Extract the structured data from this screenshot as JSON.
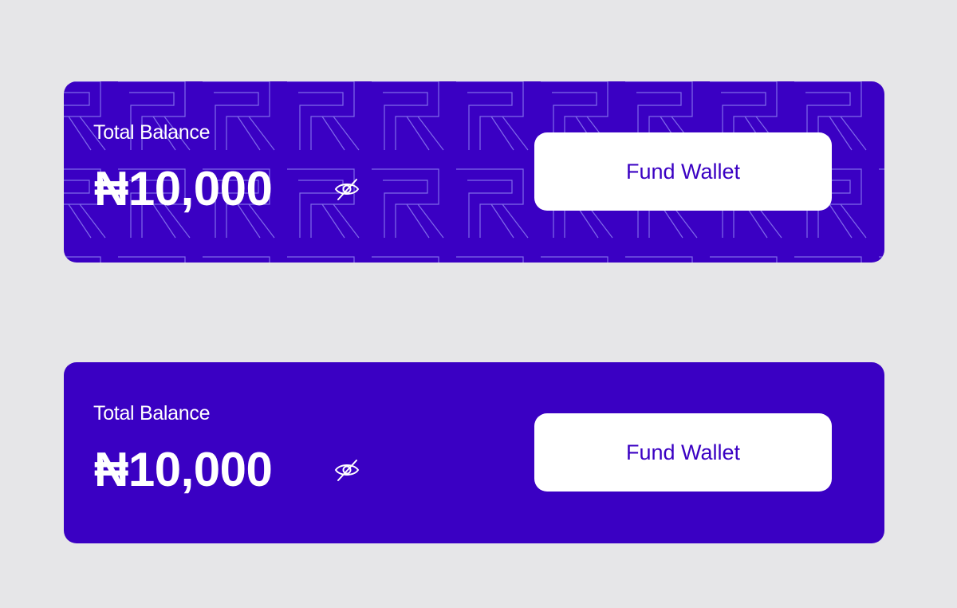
{
  "theme": {
    "page_bg": "#e6e6e8",
    "card_bg": "#3a00c3",
    "button_bg": "#ffffff",
    "button_text": "#3a00c3",
    "pattern_stroke": "#8b7cf0"
  },
  "cards": [
    {
      "variant": "patterned",
      "label": "Total Balance",
      "amount": "₦10,000",
      "toggle_icon": "eye-off-icon",
      "button_label": "Fund Wallet"
    },
    {
      "variant": "plain",
      "label": "Total Balance",
      "amount": "₦10,000",
      "toggle_icon": "eye-off-icon",
      "button_label": "Fund Wallet"
    }
  ]
}
